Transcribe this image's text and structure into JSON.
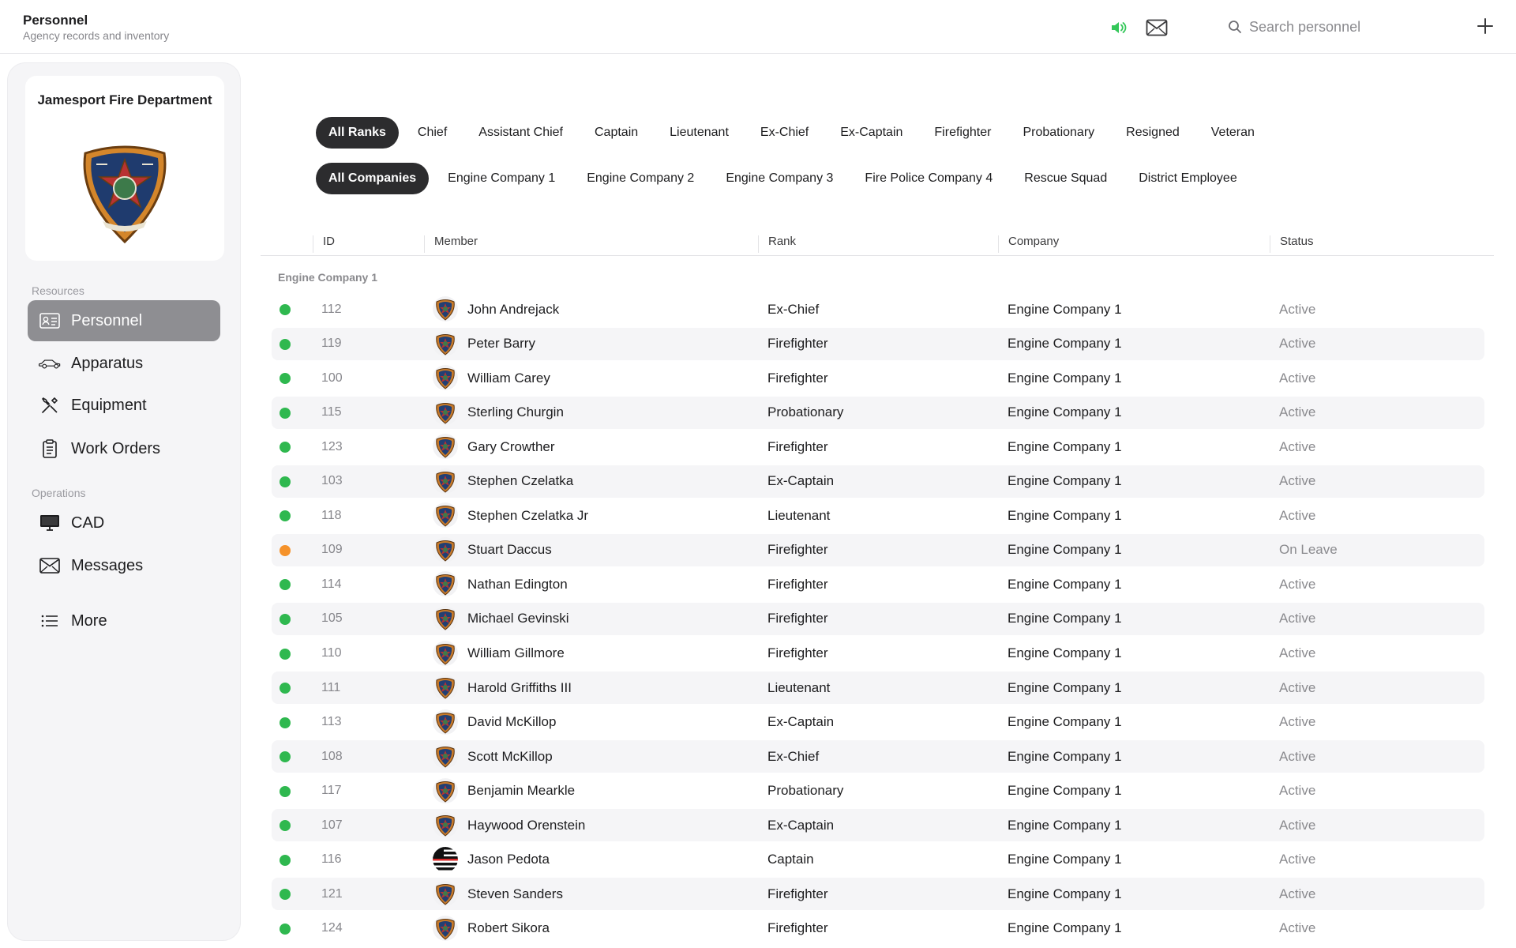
{
  "header": {
    "title": "Personnel",
    "subtitle": "Agency records and inventory",
    "search_placeholder": "Search personnel",
    "icons": [
      "speaker-icon",
      "mail-icon",
      "search-icon",
      "plus-icon"
    ]
  },
  "sidebar": {
    "org_name": "Jamesport Fire Department",
    "sections": [
      {
        "label": "Resources",
        "items": [
          {
            "label": "Personnel",
            "icon": "id-card-icon",
            "active": true
          },
          {
            "label": "Apparatus",
            "icon": "car-icon",
            "active": false
          },
          {
            "label": "Equipment",
            "icon": "tools-icon",
            "active": false
          },
          {
            "label": "Work Orders",
            "icon": "clipboard-icon",
            "active": false
          }
        ]
      },
      {
        "label": "Operations",
        "items": [
          {
            "label": "CAD",
            "icon": "monitor-icon",
            "active": false
          },
          {
            "label": "Messages",
            "icon": "mail-icon",
            "active": false
          }
        ]
      }
    ],
    "more_label": "More"
  },
  "filters": {
    "ranks": [
      "All Ranks",
      "Chief",
      "Assistant Chief",
      "Captain",
      "Lieutenant",
      "Ex-Chief",
      "Ex-Captain",
      "Firefighter",
      "Probationary",
      "Resigned",
      "Veteran"
    ],
    "ranks_selected": "All Ranks",
    "companies": [
      "All Companies",
      "Engine Company 1",
      "Engine Company 2",
      "Engine Company 3",
      "Fire Police Company 4",
      "Rescue Squad",
      "District Employee"
    ],
    "companies_selected": "All Companies"
  },
  "table": {
    "columns": [
      "ID",
      "Member",
      "Rank",
      "Company",
      "Status"
    ],
    "group": "Engine Company 1",
    "colors": {
      "active": "#2fb84f",
      "on_leave": "#f5922a"
    },
    "rows": [
      {
        "id": "112",
        "name": "John Andrejack",
        "rank": "Ex-Chief",
        "company": "Engine Company 1",
        "status": "Active",
        "avatar": "badge"
      },
      {
        "id": "119",
        "name": "Peter Barry",
        "rank": "Firefighter",
        "company": "Engine Company 1",
        "status": "Active",
        "avatar": "badge"
      },
      {
        "id": "100",
        "name": "William Carey",
        "rank": "Firefighter",
        "company": "Engine Company 1",
        "status": "Active",
        "avatar": "badge"
      },
      {
        "id": "115",
        "name": "Sterling Churgin",
        "rank": "Probationary",
        "company": "Engine Company 1",
        "status": "Active",
        "avatar": "badge"
      },
      {
        "id": "123",
        "name": "Gary Crowther",
        "rank": "Firefighter",
        "company": "Engine Company 1",
        "status": "Active",
        "avatar": "badge"
      },
      {
        "id": "103",
        "name": "Stephen Czelatka",
        "rank": "Ex-Captain",
        "company": "Engine Company 1",
        "status": "Active",
        "avatar": "badge"
      },
      {
        "id": "118",
        "name": "Stephen Czelatka Jr",
        "rank": "Lieutenant",
        "company": "Engine Company 1",
        "status": "Active",
        "avatar": "badge"
      },
      {
        "id": "109",
        "name": "Stuart Daccus",
        "rank": "Firefighter",
        "company": "Engine Company 1",
        "status": "On Leave",
        "avatar": "badge"
      },
      {
        "id": "114",
        "name": "Nathan Edington",
        "rank": "Firefighter",
        "company": "Engine Company 1",
        "status": "Active",
        "avatar": "badge"
      },
      {
        "id": "105",
        "name": "Michael Gevinski",
        "rank": "Firefighter",
        "company": "Engine Company 1",
        "status": "Active",
        "avatar": "badge"
      },
      {
        "id": "110",
        "name": "William Gillmore",
        "rank": "Firefighter",
        "company": "Engine Company 1",
        "status": "Active",
        "avatar": "badge"
      },
      {
        "id": "111",
        "name": "Harold Griffiths III",
        "rank": "Lieutenant",
        "company": "Engine Company 1",
        "status": "Active",
        "avatar": "badge"
      },
      {
        "id": "113",
        "name": "David McKillop",
        "rank": "Ex-Captain",
        "company": "Engine Company 1",
        "status": "Active",
        "avatar": "badge"
      },
      {
        "id": "108",
        "name": "Scott McKillop",
        "rank": "Ex-Chief",
        "company": "Engine Company 1",
        "status": "Active",
        "avatar": "badge"
      },
      {
        "id": "117",
        "name": "Benjamin Mearkle",
        "rank": "Probationary",
        "company": "Engine Company 1",
        "status": "Active",
        "avatar": "badge"
      },
      {
        "id": "107",
        "name": "Haywood Orenstein",
        "rank": "Ex-Captain",
        "company": "Engine Company 1",
        "status": "Active",
        "avatar": "badge"
      },
      {
        "id": "116",
        "name": "Jason Pedota",
        "rank": "Captain",
        "company": "Engine Company 1",
        "status": "Active",
        "avatar": "flag"
      },
      {
        "id": "121",
        "name": "Steven Sanders",
        "rank": "Firefighter",
        "company": "Engine Company 1",
        "status": "Active",
        "avatar": "badge"
      },
      {
        "id": "124",
        "name": "Robert Sikora",
        "rank": "Firefighter",
        "company": "Engine Company 1",
        "status": "Active",
        "avatar": "badge"
      }
    ]
  }
}
